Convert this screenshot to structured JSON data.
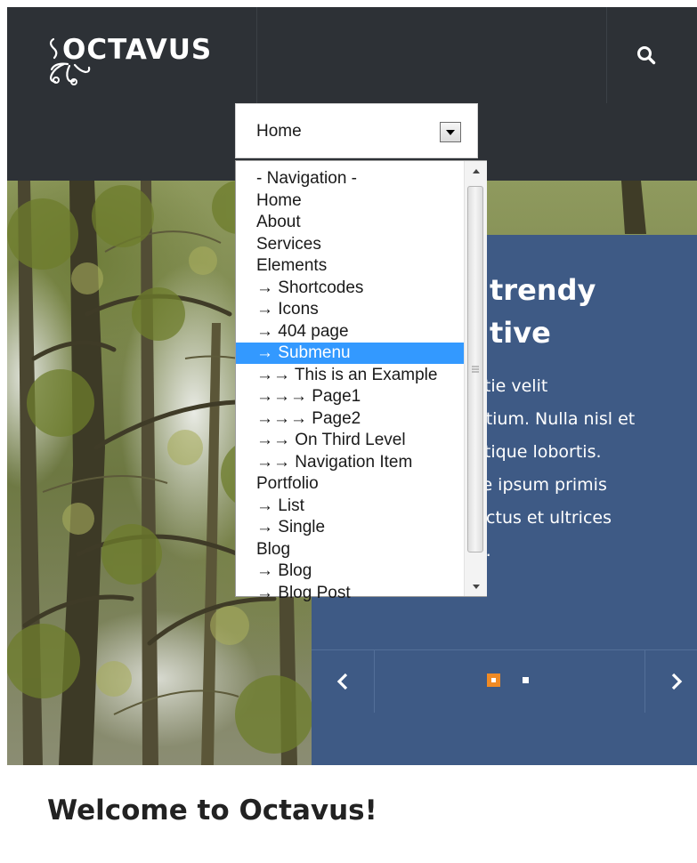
{
  "header": {
    "logo_text": "OCTAVUS",
    "search_icon": "search-icon"
  },
  "nav_select": {
    "selected_value": "Home",
    "options": [
      "- Navigation -",
      "Home",
      "About",
      "Services",
      "Elements",
      "→ Shortcodes",
      "→ Icons",
      "→ 404 page",
      "→ Submenu",
      "→→ This is an Example",
      "→→→ Page1",
      "→→→ Page2",
      "→→ On Third Level",
      "→→ Navigation Item",
      "Portfolio",
      "→ List",
      "→ Single",
      "Blog",
      "→ Blog",
      "→ Blog Post"
    ],
    "highlighted_option": "→ Submenu"
  },
  "slider": {
    "title_lines": "trendy\ntive",
    "body_lines": "stie velit\netium. Nulla nisl et\nstique lobortis.\nte ipsum primis\nuctus et ultrices\na.",
    "active_slide": 1,
    "slide_count": 2,
    "colors": {
      "panel": "#3e5a85",
      "active_dot": "#f08a24"
    }
  },
  "welcome": {
    "heading": "Welcome to Octavus!"
  }
}
